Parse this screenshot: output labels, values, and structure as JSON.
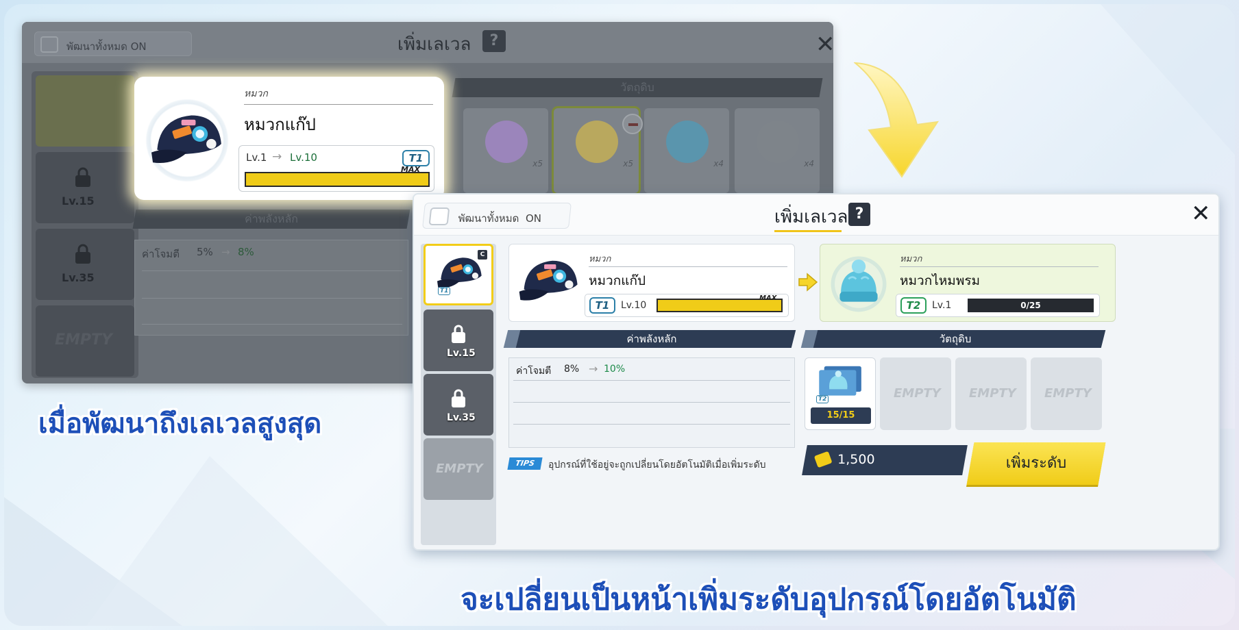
{
  "old_panel": {
    "develop_all_label": "พัฒนาทั้งหมด",
    "develop_all_state": "ON",
    "title": "เพิ่มเลเวล",
    "help": "?",
    "close": "✕",
    "materials_header": "วัตถุดิบ",
    "stats_header": "ค่าพลังหลัก",
    "item_category": "หมวก",
    "item_name": "หมวกแก๊ป",
    "level_from": "Lv.1",
    "level_arrow": "→",
    "level_to": "Lv.10",
    "tier": "T1",
    "max_label": "MAX",
    "stat_name": "ค่าโจมตี",
    "stat_old": "5%",
    "stat_new": "8%",
    "slots": [
      {
        "label": "Lv.15"
      },
      {
        "label": "Lv.35"
      },
      {
        "label": "EMPTY"
      }
    ],
    "materials": [
      {
        "count": "x5",
        "value": "0",
        "color": "#b69cd9"
      },
      {
        "count": "x5",
        "value": "1",
        "color": "#e9d36e"
      },
      {
        "count": "x4",
        "value": "0",
        "color": "#7cc6e4"
      },
      {
        "count": "x4",
        "value": "0",
        "color": "#a6acb2"
      }
    ]
  },
  "caption_top": "เมื่อพัฒนาถึงเลเวลสูงสุด",
  "caption_bottom": "จะเปลี่ยนเป็นหน้าเพิ่มระดับอุปกรณ์โดยอัตโนมัติ",
  "panel": {
    "develop_all_label": "พัฒนาทั้งหมด",
    "develop_all_state": "ON",
    "title": "เพิ่มเลเวล",
    "help": "?",
    "close": "✕",
    "sidebar": [
      {
        "label": "",
        "type": "selected",
        "tier": "T1"
      },
      {
        "label": "Lv.15",
        "type": "locked"
      },
      {
        "label": "Lv.35",
        "type": "locked"
      },
      {
        "label": "EMPTY",
        "type": "empty"
      }
    ],
    "current": {
      "category": "หมวก",
      "name": "หมวกแก๊ป",
      "tier": "T1",
      "level": "Lv.10",
      "max_label": "MAX"
    },
    "next": {
      "category": "หมวก",
      "name": "หมวกไหมพรม",
      "tier": "T2",
      "level": "Lv.1",
      "progress_text": "0/25"
    },
    "stats_header": "ค่าพลังหลัก",
    "stats": [
      {
        "name": "ค่าโจมตี",
        "old": "8%",
        "arrow": "→",
        "new": "10%"
      }
    ],
    "materials_header": "วัตถุดิบ",
    "materials": [
      {
        "type": "filled",
        "tier": "T2",
        "count": "15/15"
      },
      {
        "type": "empty",
        "label": "EMPTY"
      },
      {
        "type": "empty",
        "label": "EMPTY"
      },
      {
        "type": "empty",
        "label": "EMPTY"
      }
    ],
    "tips_badge": "TIPS",
    "tips_text": "อุปกรณ์ที่ใช้อยู่จะถูกเปลี่ยนโดยอัตโนมัติเมื่อเพิ่มระดับ",
    "cost": "1,500",
    "upgrade_button": "เพิ่มระดับ"
  },
  "colors": {
    "accent_yellow": "#f0cc18",
    "header_navy": "#2d3c54",
    "caption_blue": "#1d4fb8",
    "next_card_bg": "#eef7dd"
  }
}
